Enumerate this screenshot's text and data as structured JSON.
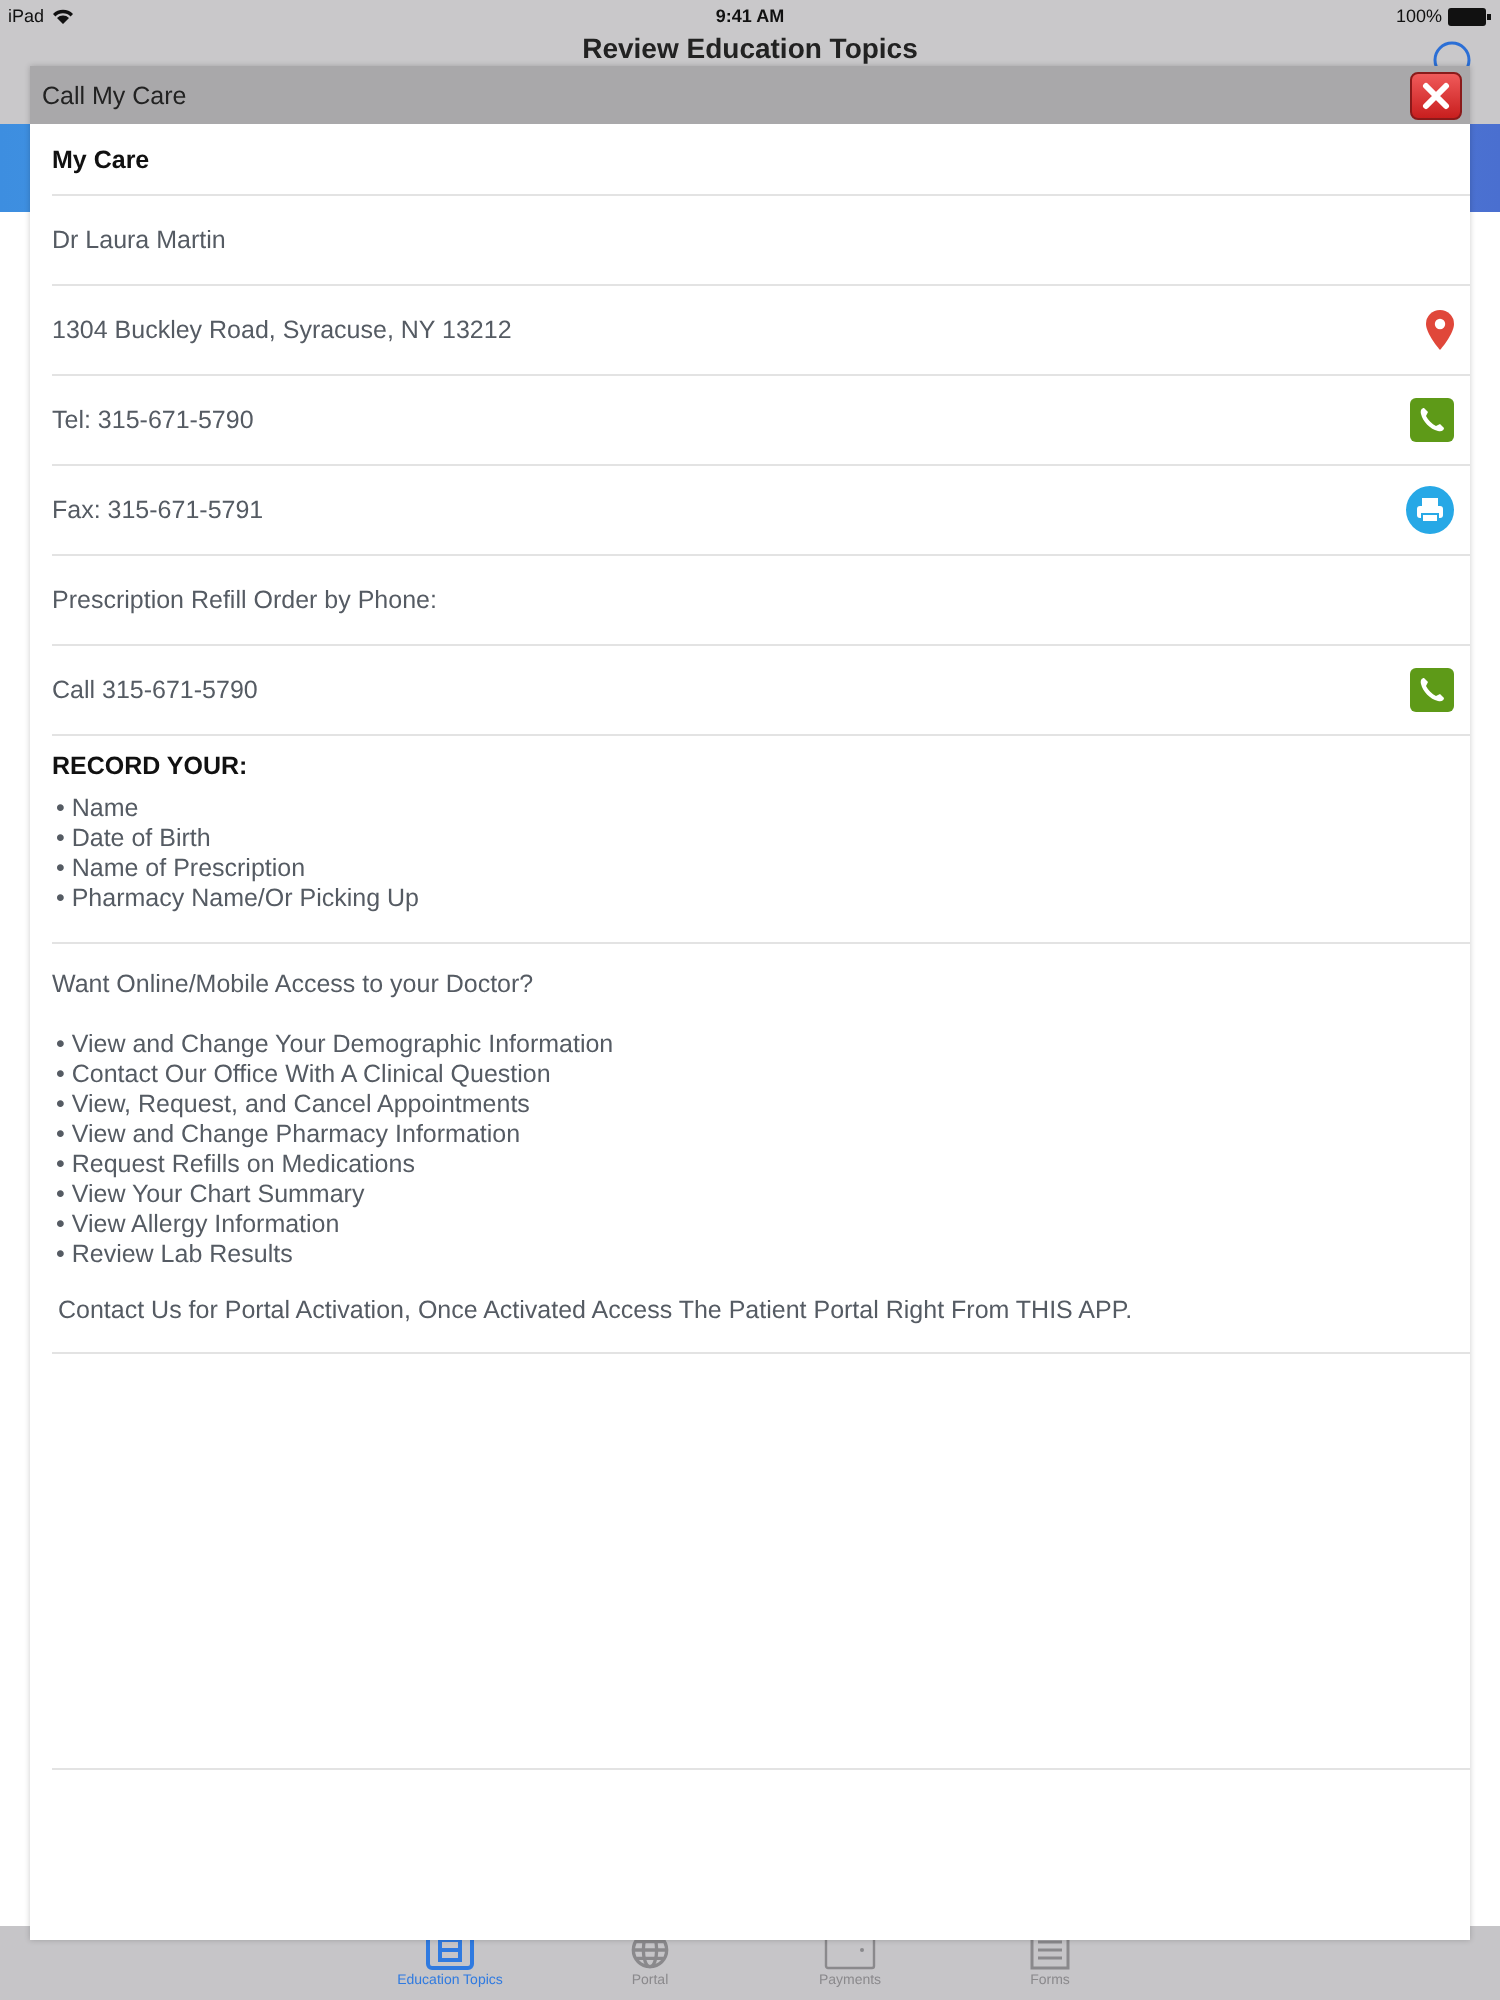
{
  "status_bar": {
    "device": "iPad",
    "time": "9:41 AM",
    "battery": "100%"
  },
  "nav_bar": {
    "title": "Review Education Topics"
  },
  "modal": {
    "title": "Call My Care",
    "heading": "My Care",
    "rows": [
      {
        "text": "Dr Laura Martin"
      },
      {
        "text": "1304 Buckley Road, Syracuse, NY 13212",
        "kind": "address"
      },
      {
        "text": "Tel: 315-671-5790",
        "kind": "phone"
      },
      {
        "text": "Fax: 315-671-5791",
        "kind": "fax"
      },
      {
        "text": "Prescription Refill Order by Phone:"
      },
      {
        "text": "Call 315-671-5790",
        "kind": "phone"
      }
    ],
    "record": {
      "heading": "RECORD YOUR:",
      "items": [
        "• Name",
        "• Date of Birth",
        "• Name of Prescription",
        "• Pharmacy Name/Or Picking Up"
      ]
    },
    "portal": {
      "question": "Want Online/Mobile Access to your Doctor?",
      "items": [
        "• View and Change Your Demographic Information",
        "• Contact Our Office With A Clinical Question",
        "• View, Request, and Cancel Appointments",
        "• View and Change Pharmacy Information",
        "• Request Refills on Medications",
        "• View Your Chart Summary",
        "• View Allergy Information",
        "• Review Lab Results"
      ],
      "note": "Contact Us for Portal Activation, Once Activated Access The Patient Portal Right From THIS APP."
    }
  },
  "tab_bar": [
    {
      "label": "Education Topics",
      "selected": true
    },
    {
      "label": "Portal",
      "selected": false
    },
    {
      "label": "Payments",
      "selected": false
    },
    {
      "label": "Forms",
      "selected": false
    }
  ]
}
